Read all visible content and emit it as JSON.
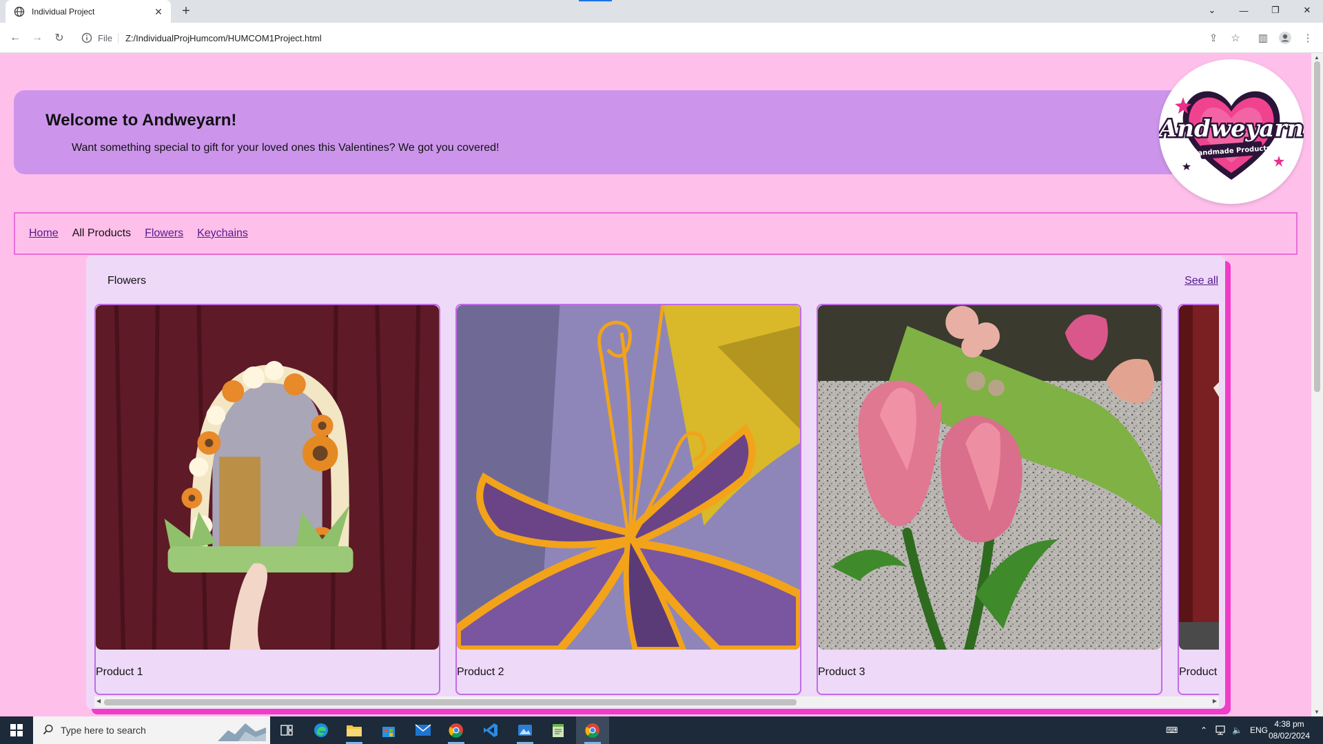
{
  "browser": {
    "tab_title": "Individual Project",
    "address_scheme": "File",
    "address_url": "Z:/IndividualProjHumcom/HUMCOM1Project.html"
  },
  "banner": {
    "heading": "Welcome to Andweyarn!",
    "subtext": "Want something special to gift for your loved ones this Valentines? We got you covered!"
  },
  "logo": {
    "brand": "Andweyarn",
    "tagline": "Handmade Products"
  },
  "nav": {
    "items": [
      {
        "label": "Home",
        "current": false
      },
      {
        "label": "All Products",
        "current": true
      },
      {
        "label": "Flowers",
        "current": false
      },
      {
        "label": "Keychains",
        "current": false
      }
    ]
  },
  "section": {
    "title": "Flowers",
    "see_all": "See all",
    "products": [
      {
        "name": "Product 1",
        "image": "crochet-flower-mirror"
      },
      {
        "name": "Product 2",
        "image": "crochet-purple-lily"
      },
      {
        "name": "Product 3",
        "image": "crochet-pink-tulips"
      },
      {
        "name": "Product",
        "image": "crochet-product-partial"
      }
    ]
  },
  "taskbar": {
    "search_placeholder": "Type here to search",
    "language": "ENG",
    "time": "4:38 pm",
    "date": "08/02/2024"
  },
  "colors": {
    "page_bg": "#ffbfeb",
    "banner_bg": "#cc95eb",
    "section_bg": "#eed9f8",
    "section_shadow": "#f03cc7",
    "nav_border": "#e86ed6",
    "card_border": "#c06ce6"
  }
}
